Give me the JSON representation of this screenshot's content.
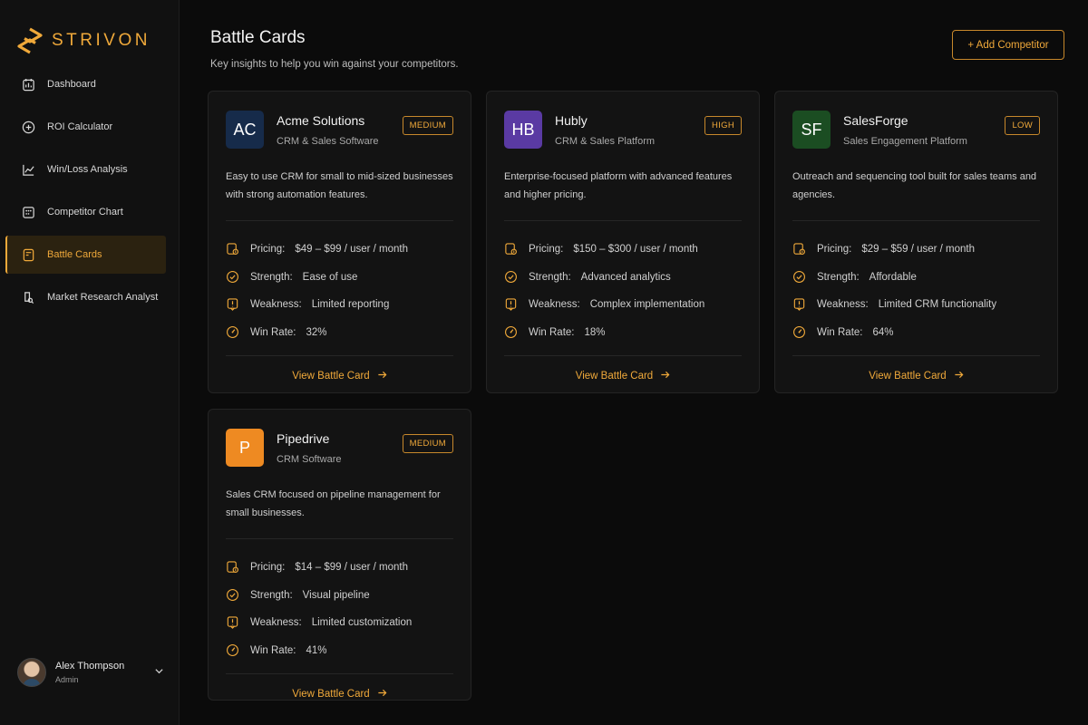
{
  "brand": {
    "name": "STRIVON",
    "accent": "#f0a93a"
  },
  "sidebar": {
    "items": [
      {
        "label": "Dashboard",
        "icon": "dashboard-icon"
      },
      {
        "label": "ROI Calculator",
        "icon": "plus-circle-icon"
      },
      {
        "label": "Win/Loss Analysis",
        "icon": "line-chart-icon"
      },
      {
        "label": "Competitor Chart",
        "icon": "grid-calendar-icon"
      },
      {
        "label": "Battle Cards",
        "icon": "card-icon",
        "active": true
      },
      {
        "label": "Market Research Analyst",
        "icon": "search-doc-icon"
      }
    ],
    "user": {
      "name": "Alex Thompson",
      "role": "Admin"
    }
  },
  "header": {
    "title": "Battle Cards",
    "subtitle": "Key insights to help you win against your competitors.",
    "add_button": "+ Add Competitor"
  },
  "cards": [
    {
      "initials": "AC",
      "logo_color": "#162b4a",
      "name": "Acme Solutions",
      "category": "CRM & Sales Software",
      "badge": "MEDIUM",
      "description": "Easy to use CRM for small to mid-sized businesses with strong automation features.",
      "pricing_label": "Pricing:",
      "pricing": "$49 – $99 / user / month",
      "strength_label": "Strength:",
      "strength": "Ease of use",
      "weakness_label": "Weakness:",
      "weakness": "Limited reporting",
      "winrate_label": "Win Rate:",
      "winrate": "32%",
      "link": "View Battle Card"
    },
    {
      "initials": "HB",
      "logo_color": "#5a3aa3",
      "name": "Hubly",
      "category": "CRM & Sales Platform",
      "badge": "HIGH",
      "description": "Enterprise-focused platform with advanced features and higher pricing.",
      "pricing_label": "Pricing:",
      "pricing": "$150 – $300 / user / month",
      "strength_label": "Strength:",
      "strength": "Advanced analytics",
      "weakness_label": "Weakness:",
      "weakness": "Complex implementation",
      "winrate_label": "Win Rate:",
      "winrate": "18%",
      "link": "View Battle Card"
    },
    {
      "initials": "SF",
      "logo_color": "#1b4d22",
      "name": "SalesForge",
      "category": "Sales Engagement Platform",
      "badge": "LOW",
      "description": "Outreach and sequencing tool built for sales teams and agencies.",
      "pricing_label": "Pricing:",
      "pricing": "$29 – $59 / user / month",
      "strength_label": "Strength:",
      "strength": "Affordable",
      "weakness_label": "Weakness:",
      "weakness": "Limited CRM functionality",
      "winrate_label": "Win Rate:",
      "winrate": "64%",
      "link": "View Battle Card"
    },
    {
      "initials": "P",
      "logo_color": "#ee8a22",
      "name": "Pipedrive",
      "category": "CRM Software",
      "badge": "MEDIUM",
      "description": "Sales CRM focused on pipeline management for small businesses.",
      "pricing_label": "Pricing:",
      "pricing": "$14 – $99 / user / month",
      "strength_label": "Strength:",
      "strength": "Visual pipeline",
      "weakness_label": "Weakness:",
      "weakness": "Limited customization",
      "winrate_label": "Win Rate:",
      "winrate": "41%",
      "link": "View Battle Card"
    }
  ]
}
